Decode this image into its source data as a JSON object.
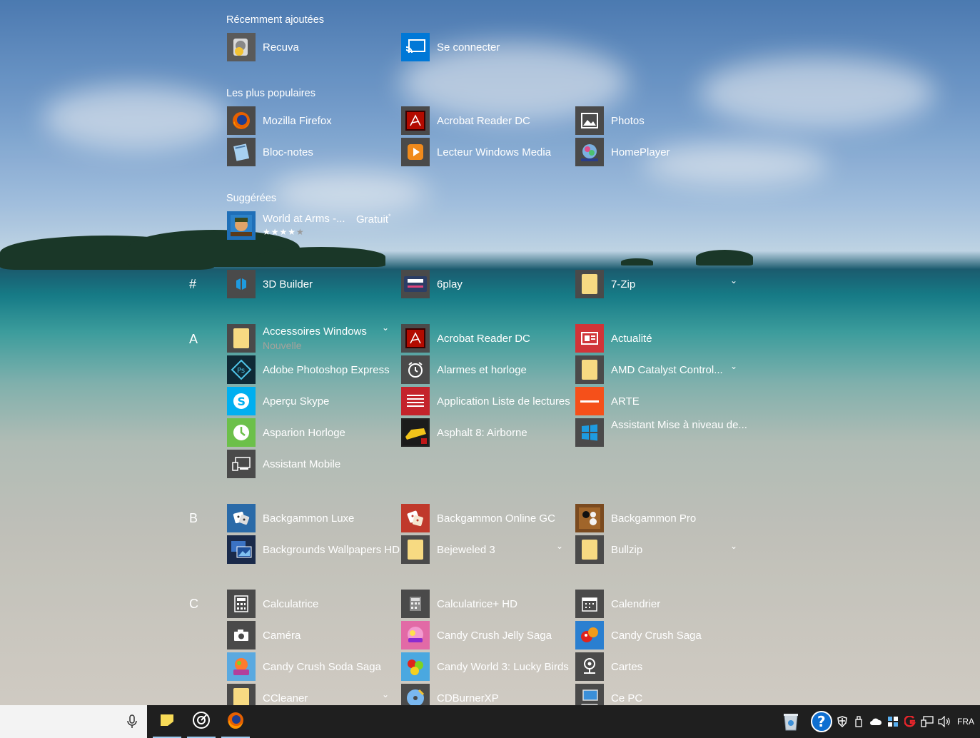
{
  "sections": {
    "recent": "Récemment ajoutées",
    "popular": "Les plus populaires",
    "suggested": "Suggérées"
  },
  "recent_apps": [
    {
      "label": "Recuva"
    },
    {
      "label": "Se connecter"
    }
  ],
  "popular_apps": [
    {
      "label": "Mozilla Firefox"
    },
    {
      "label": "Acrobat Reader DC"
    },
    {
      "label": "Photos"
    },
    {
      "label": "Bloc-notes"
    },
    {
      "label": "Lecteur Windows Media"
    },
    {
      "label": "HomePlayer"
    }
  ],
  "suggested_app": {
    "label": "World at Arms -...",
    "price": "Gratuit",
    "price_mark": "*",
    "stars": "★★★★",
    "star_empty": "★",
    "rating": 4
  },
  "letters": [
    "#",
    "A",
    "B",
    "C"
  ],
  "hash_apps": [
    {
      "label": "3D Builder"
    },
    {
      "label": "6play"
    },
    {
      "label": "7-Zip"
    }
  ],
  "a_apps": [
    {
      "label": "Accessoires Windows",
      "sub": "Nouvelle"
    },
    {
      "label": "Acrobat Reader DC"
    },
    {
      "label": "Actualité"
    },
    {
      "label": "Adobe Photoshop Express"
    },
    {
      "label": "Alarmes et horloge"
    },
    {
      "label": "AMD Catalyst Control..."
    },
    {
      "label": "Aperçu Skype"
    },
    {
      "label": "Application Liste de lectures"
    },
    {
      "label": "ARTE"
    },
    {
      "label": "Asparion Horloge"
    },
    {
      "label": "Asphalt 8: Airborne"
    },
    {
      "label": "Assistant Mise à niveau de..."
    },
    {
      "label": "Assistant Mobile"
    }
  ],
  "b_apps": [
    {
      "label": "Backgammon Luxe"
    },
    {
      "label": "Backgammon Online GC"
    },
    {
      "label": "Backgammon Pro"
    },
    {
      "label": "Backgrounds Wallpapers HD"
    },
    {
      "label": "Bejeweled 3"
    },
    {
      "label": "Bullzip"
    }
  ],
  "c_apps": [
    {
      "label": "Calculatrice"
    },
    {
      "label": "Calculatrice+ HD"
    },
    {
      "label": "Calendrier"
    },
    {
      "label": "Caméra"
    },
    {
      "label": "Candy Crush Jelly Saga"
    },
    {
      "label": "Candy Crush Saga"
    },
    {
      "label": "Candy Crush Soda Saga"
    },
    {
      "label": "Candy World 3: Lucky Birds"
    },
    {
      "label": "Cartes"
    },
    {
      "label": "CCleaner"
    },
    {
      "label": "CDBurnerXP"
    },
    {
      "label": "Ce PC"
    }
  ],
  "expand_glyph": "⌄",
  "taskbar": {
    "language": "FRA",
    "icons": [
      "microphone-icon",
      "sticky-notes-icon",
      "groove-icon",
      "firefox-icon",
      "recycle-bin-icon",
      "help-icon",
      "defender-icon",
      "usb-icon",
      "onedrive-icon",
      "network-adapter-icon",
      "antivirus-icon",
      "network-icon",
      "volume-icon"
    ]
  },
  "colors": {
    "accent": "#0078d7",
    "tile_bg": "#4a4a4a",
    "taskbar": "#1f1f1f"
  }
}
